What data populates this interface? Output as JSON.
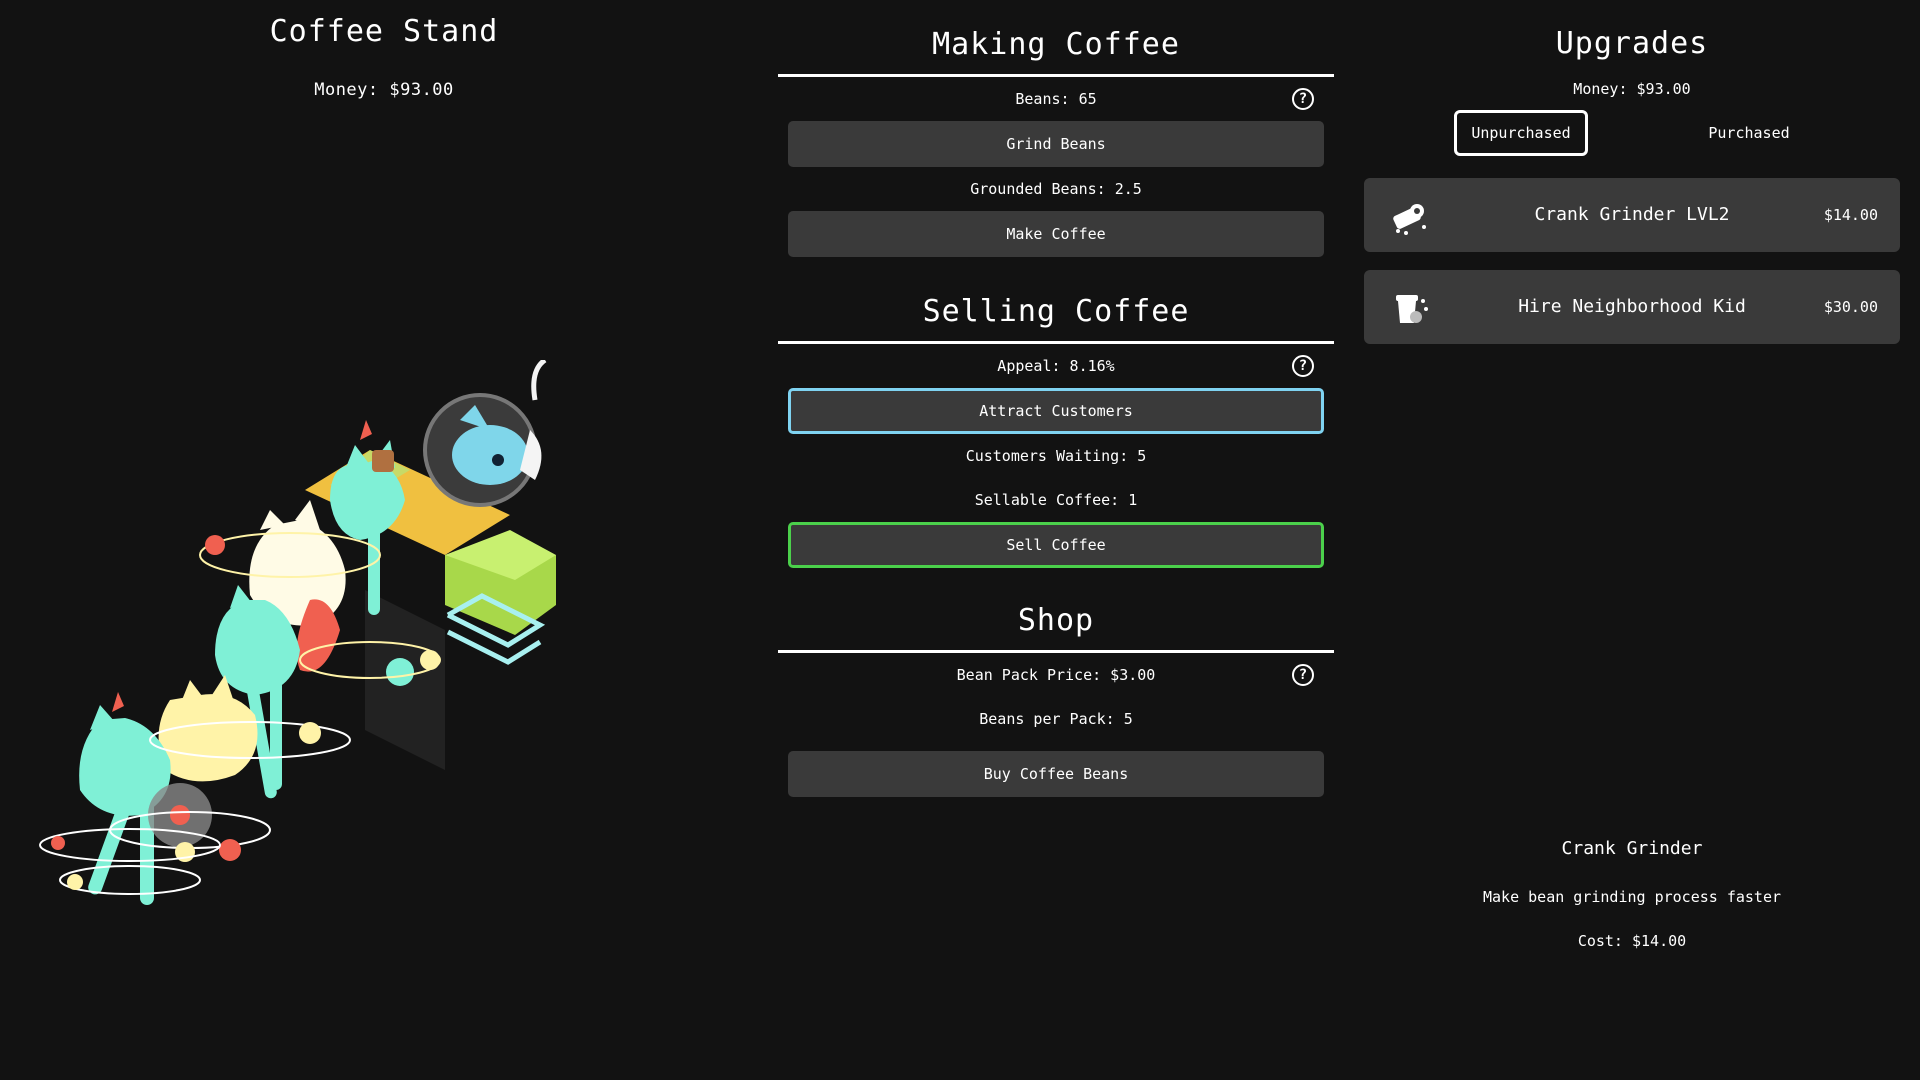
{
  "stand": {
    "title": "Coffee Stand",
    "money": "Money: $93.00"
  },
  "making": {
    "title": "Making Coffee",
    "beans": "Beans: 65",
    "grind_label": "Grind Beans",
    "grounded": "Grounded Beans: 2.5",
    "make_label": "Make Coffee"
  },
  "selling": {
    "title": "Selling Coffee",
    "appeal": "Appeal: 8.16%",
    "attract_label": "Attract Customers",
    "waiting": "Customers Waiting: 5",
    "sellable": "Sellable Coffee: 1",
    "sell_label": "Sell Coffee"
  },
  "shop": {
    "title": "Shop",
    "price": "Bean Pack Price: $3.00",
    "per_pack": "Beans per Pack: 5",
    "buy_label": "Buy Coffee Beans"
  },
  "help_glyph": "?",
  "upgrades": {
    "title": "Upgrades",
    "money": "Money: $93.00",
    "tabs": [
      "Unpurchased",
      "Purchased"
    ],
    "items": [
      {
        "name": "Crank Grinder LVL2",
        "price": "$14.00",
        "icon": "grinder-icon"
      },
      {
        "name": "Hire Neighborhood Kid",
        "price": "$30.00",
        "icon": "coffee-cup-icon"
      }
    ],
    "detail": {
      "title": "Crank Grinder",
      "text": "Make bean grinding process faster",
      "cost": "Cost: $14.00"
    }
  },
  "colors": {
    "background": "#121212",
    "button": "#3a3a3a",
    "attract_border": "#7fd3f1",
    "sell_border": "#4bd04b",
    "cat_teal": "#7ff0d6",
    "counter_yellow": "#f0c040",
    "counter_green": "#c0ec6a",
    "accent_red": "#f06050"
  }
}
